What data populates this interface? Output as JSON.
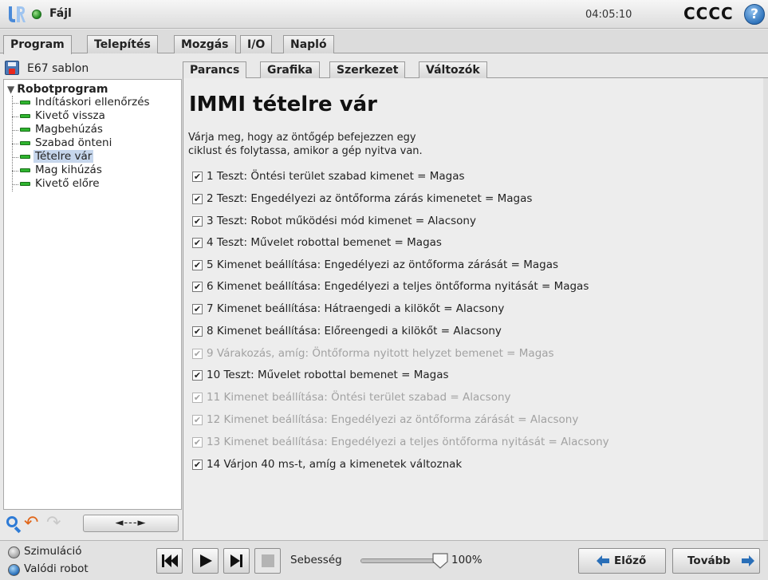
{
  "topbar": {
    "file_menu": "Fájl",
    "time": "04:05:10",
    "robot_name": "CCCC",
    "help_symbol": "?"
  },
  "main_tabs": [
    {
      "label": "Program",
      "active": true
    },
    {
      "label": "Telepítés",
      "active": false
    },
    {
      "label": "Mozgás",
      "active": false
    },
    {
      "label": "I/O",
      "active": false
    },
    {
      "label": "Napló",
      "active": false
    }
  ],
  "left_panel": {
    "template_name": "E67 sablon",
    "tree": {
      "root_label": "Robotprogram",
      "items": [
        {
          "label": "Indításkori ellenőrzés",
          "selected": false
        },
        {
          "label": "Kivető vissza",
          "selected": false
        },
        {
          "label": "Magbehúzás",
          "selected": false
        },
        {
          "label": "Szabad önteni",
          "selected": false
        },
        {
          "label": "Tételre vár",
          "selected": true
        },
        {
          "label": "Mag kihúzás",
          "selected": false
        },
        {
          "label": "Kivető előre",
          "selected": false
        }
      ]
    },
    "move_button_label": "◄---►"
  },
  "sub_tabs": [
    {
      "label": "Parancs",
      "active": true
    },
    {
      "label": "Grafika",
      "active": false
    },
    {
      "label": "Szerkezet",
      "active": false
    },
    {
      "label": "Változók",
      "active": false
    }
  ],
  "command": {
    "title": "IMMI tételre vár",
    "description_line1": "Várja meg, hogy az öntőgép befejezzen egy",
    "description_line2": "ciklust és folytassa, amikor a gép nyitva van.",
    "checkmark": "✔",
    "items": [
      {
        "label": "1 Teszt: Öntési terület szabad kimenet = Magas",
        "checked": true,
        "enabled": true
      },
      {
        "label": "2 Teszt: Engedélyezi az öntőforma zárás kimenetet = Magas",
        "checked": true,
        "enabled": true
      },
      {
        "label": "3 Teszt: Robot működési mód kimenet = Alacsony",
        "checked": true,
        "enabled": true
      },
      {
        "label": "4 Teszt: Művelet robottal bemenet = Magas",
        "checked": true,
        "enabled": true
      },
      {
        "label": "5 Kimenet beállítása: Engedélyezi az öntőforma zárását = Magas",
        "checked": true,
        "enabled": true
      },
      {
        "label": "6 Kimenet beállítása: Engedélyezi a teljes öntőforma nyitását = Magas",
        "checked": true,
        "enabled": true
      },
      {
        "label": "7 Kimenet beállítása: Hátraengedi a kilökőt = Alacsony",
        "checked": true,
        "enabled": true
      },
      {
        "label": "8 Kimenet beállítása: Előreengedi a kilökőt = Alacsony",
        "checked": true,
        "enabled": true
      },
      {
        "label": "9 Várakozás, amíg: Öntőforma nyitott helyzet bemenet = Magas",
        "checked": true,
        "enabled": false
      },
      {
        "label": "10 Teszt: Művelet robottal bemenet = Magas",
        "checked": true,
        "enabled": true
      },
      {
        "label": "11 Kimenet beállítása: Öntési terület szabad = Alacsony",
        "checked": true,
        "enabled": false
      },
      {
        "label": "12 Kimenet beállítása: Engedélyezi az öntőforma zárását = Alacsony",
        "checked": true,
        "enabled": false
      },
      {
        "label": "13 Kimenet beállítása: Engedélyezi a teljes öntőforma nyitását = Alacsony",
        "checked": true,
        "enabled": false
      },
      {
        "label": "14 Várjon 40 ms-t, amíg a kimenetek változnak",
        "checked": true,
        "enabled": true
      }
    ]
  },
  "bottom": {
    "simulation_label": "Szimuláció",
    "real_robot_label": "Valódi robot",
    "selected_mode": "Valódi robot",
    "speed_label": "Sebesség",
    "speed_value": "100%",
    "speed_fraction": 1.0,
    "prev_label": "Előző",
    "next_label": "Tovább"
  }
}
